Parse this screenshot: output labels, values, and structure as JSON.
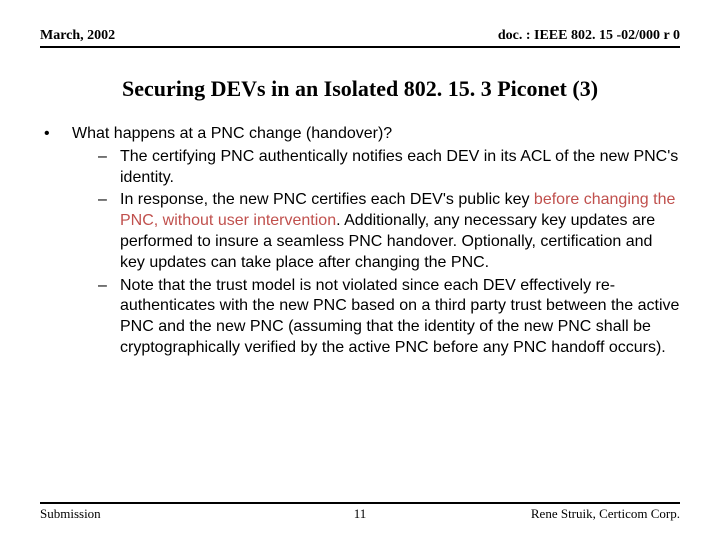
{
  "header": {
    "left": "March, 2002",
    "right": "doc. : IEEE 802. 15 -02/000 r 0"
  },
  "title": "Securing DEVs in an Isolated 802. 15. 3 Piconet (3)",
  "bullet": {
    "mark": "•",
    "text": "What happens at a PNC change (handover)?"
  },
  "subs": {
    "mark": "–",
    "items": [
      {
        "plain": "The certifying PNC authentically notifies each DEV in its ACL of the new PNC's identity."
      },
      {
        "lead": "In response, the new PNC certifies each DEV's public key ",
        "accent": "before changing the PNC, without user intervention",
        "tail": ".  Additionally, any necessary key updates are performed to insure a seamless PNC handover.  Optionally, certification and key updates can take place after changing the PNC."
      },
      {
        "plain": "Note that the trust model is not violated since each DEV effectively re-authenticates with the new PNC based on a third party trust between  the active PNC and the new PNC (assuming that the identity of the new PNC shall be cryptographically verified by the active PNC before any PNC handoff occurs)."
      }
    ]
  },
  "footer": {
    "left": "Submission",
    "center": "11",
    "right": "Rene Struik, Certicom Corp."
  }
}
